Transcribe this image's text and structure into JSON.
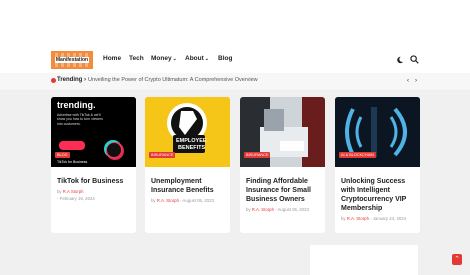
{
  "logo": {
    "text": "Manifestation"
  },
  "nav": {
    "items": [
      {
        "label": "Home"
      },
      {
        "label": "Tech"
      },
      {
        "label": "Money"
      },
      {
        "label": "About"
      },
      {
        "label": "Blog"
      }
    ],
    "icons": [
      "dark-mode-icon",
      "search-icon"
    ]
  },
  "trending": {
    "label": "Trending ›",
    "headline": "Unveiling the Power of Crypto Ultimatum: A Comprehensive Overview"
  },
  "cards": [
    {
      "title": "TikTok for Business",
      "badge": "BLOG",
      "by": "by",
      "author": "R.A Storph",
      "date": "- February 19, 2024",
      "image_text": "trending.",
      "image_sub": "Advertise with TikTok & we'll show you how to turn viewers into customers.",
      "image_tag": "TikTok for Business"
    },
    {
      "title": "Unemployment Insurance Benefits",
      "badge": "INSURANCE",
      "by": "by",
      "author": "R.A. Storph",
      "date": "- August 05, 2023",
      "image_text": "EMPLOYEE",
      "image_text2": "BENEFITS"
    },
    {
      "title": "Finding Affordable Insurance for Small Business Owners",
      "badge": "INSURANCE",
      "by": "by",
      "author": "R.A. Storph",
      "date": "- August 05, 2023"
    },
    {
      "title": "Unlocking Success with Intelligent Cryptocurrency VIP Membership",
      "badge": "AI & BLOCKCHAIN",
      "by": "by",
      "author": "R.A. Storph",
      "date": "- January 24, 2024"
    }
  ],
  "colors": {
    "accent": "#e53935",
    "background": "#f0f0f0"
  }
}
